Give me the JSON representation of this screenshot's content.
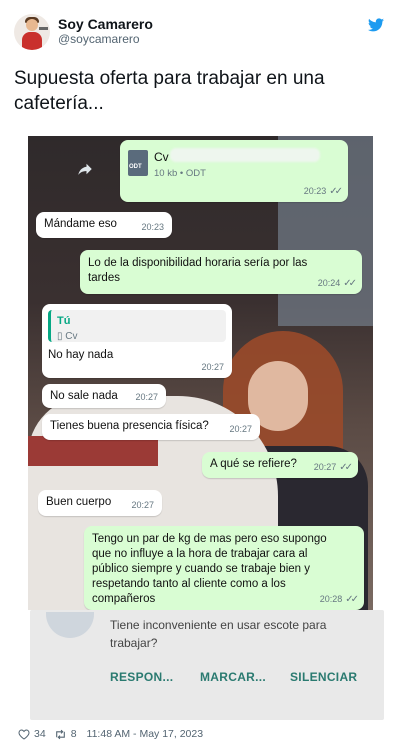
{
  "user": {
    "name": "Soy Camarero",
    "handle": "@soycamarero"
  },
  "tweet": {
    "text": "Supuesta oferta para trabajar en una cafetería..."
  },
  "chat": {
    "file": {
      "name": "Cv",
      "meta": "10 kb • ODT",
      "time": "20:23",
      "icon_label": "ODT"
    },
    "messages": [
      {
        "text": "Mándame eso",
        "time": "20:23"
      },
      {
        "text": "Lo de la disponibilidad horaria sería por las tardes",
        "time": "20:24"
      },
      {
        "quote_name": "Tú",
        "quote_text": "Cv",
        "text": "No hay nada",
        "time": "20:27"
      },
      {
        "text": "No sale nada",
        "time": "20:27"
      },
      {
        "text": "Tienes buena presencia física?",
        "time": "20:27"
      },
      {
        "text": "A qué se refiere?",
        "time": "20:27"
      },
      {
        "text": "Buen cuerpo",
        "time": "20:27"
      },
      {
        "text": "Tengo un par de kg de mas pero eso supongo que no influye a la hora de trabajar cara al público siempre y cuando se trabaje bien y respetando tanto al cliente como a los compañeros",
        "time": "20:28"
      }
    ]
  },
  "notification": {
    "text": "Tiene inconveniente en usar escote para trabajar?",
    "buttons": [
      "RESPON...",
      "MARCAR...",
      "SILENCIAR"
    ]
  },
  "footer": {
    "likes": "34",
    "retweets": "8",
    "timestamp": "11:48 AM - May 17, 2023"
  },
  "colors": {
    "twitter_blue": "#1d9bf0",
    "chat_out": "#d9fdd3",
    "chat_in": "#ffffff",
    "notif_action": "#2a7a70"
  }
}
